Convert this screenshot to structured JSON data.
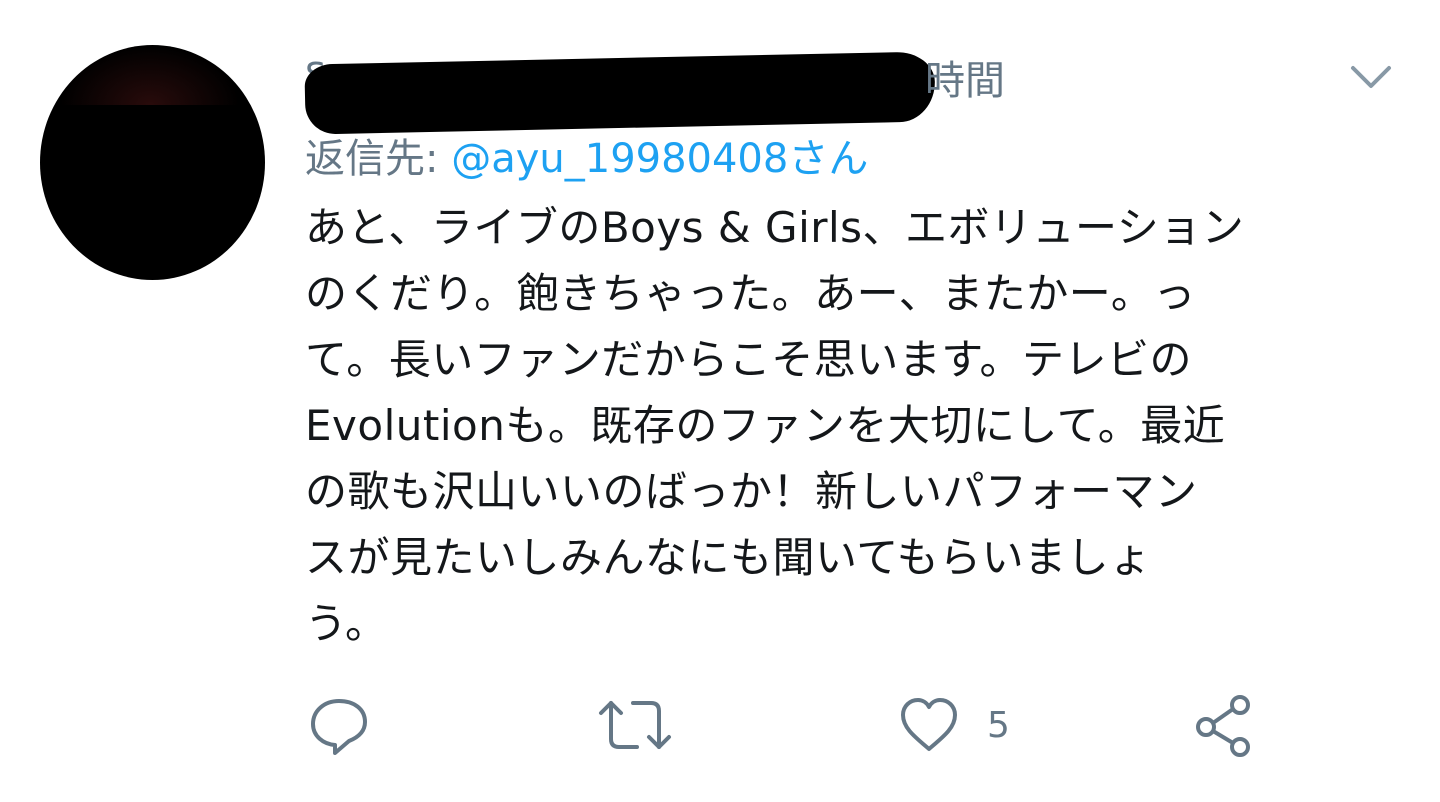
{
  "tweet": {
    "header_name_visible": "s",
    "time": "時間",
    "reply_prefix": "返信先: ",
    "reply_handle": "@ayu_19980408さん",
    "body_lines": [
      "あと、ライブのBoys & Girls、エボリューション",
      "のくだり。飽きちゃった。あー、またかー。っ",
      "て。長いファンだからこそ思います。テレビの",
      "Evolutionも。既存のファンを大切にして。最近",
      "の歌も沢山いいのばっか！新しいパフォーマン",
      "スが見たいしみんなにも聞いてもらいましょ",
      "う。"
    ],
    "like_count": "5"
  },
  "colors": {
    "text": "#14171a",
    "secondary": "#657786",
    "link": "#1da1f2",
    "icon": "#657786"
  },
  "icons": [
    "chevron-down-icon",
    "reply-icon",
    "retweet-icon",
    "heart-icon",
    "share-icon"
  ]
}
